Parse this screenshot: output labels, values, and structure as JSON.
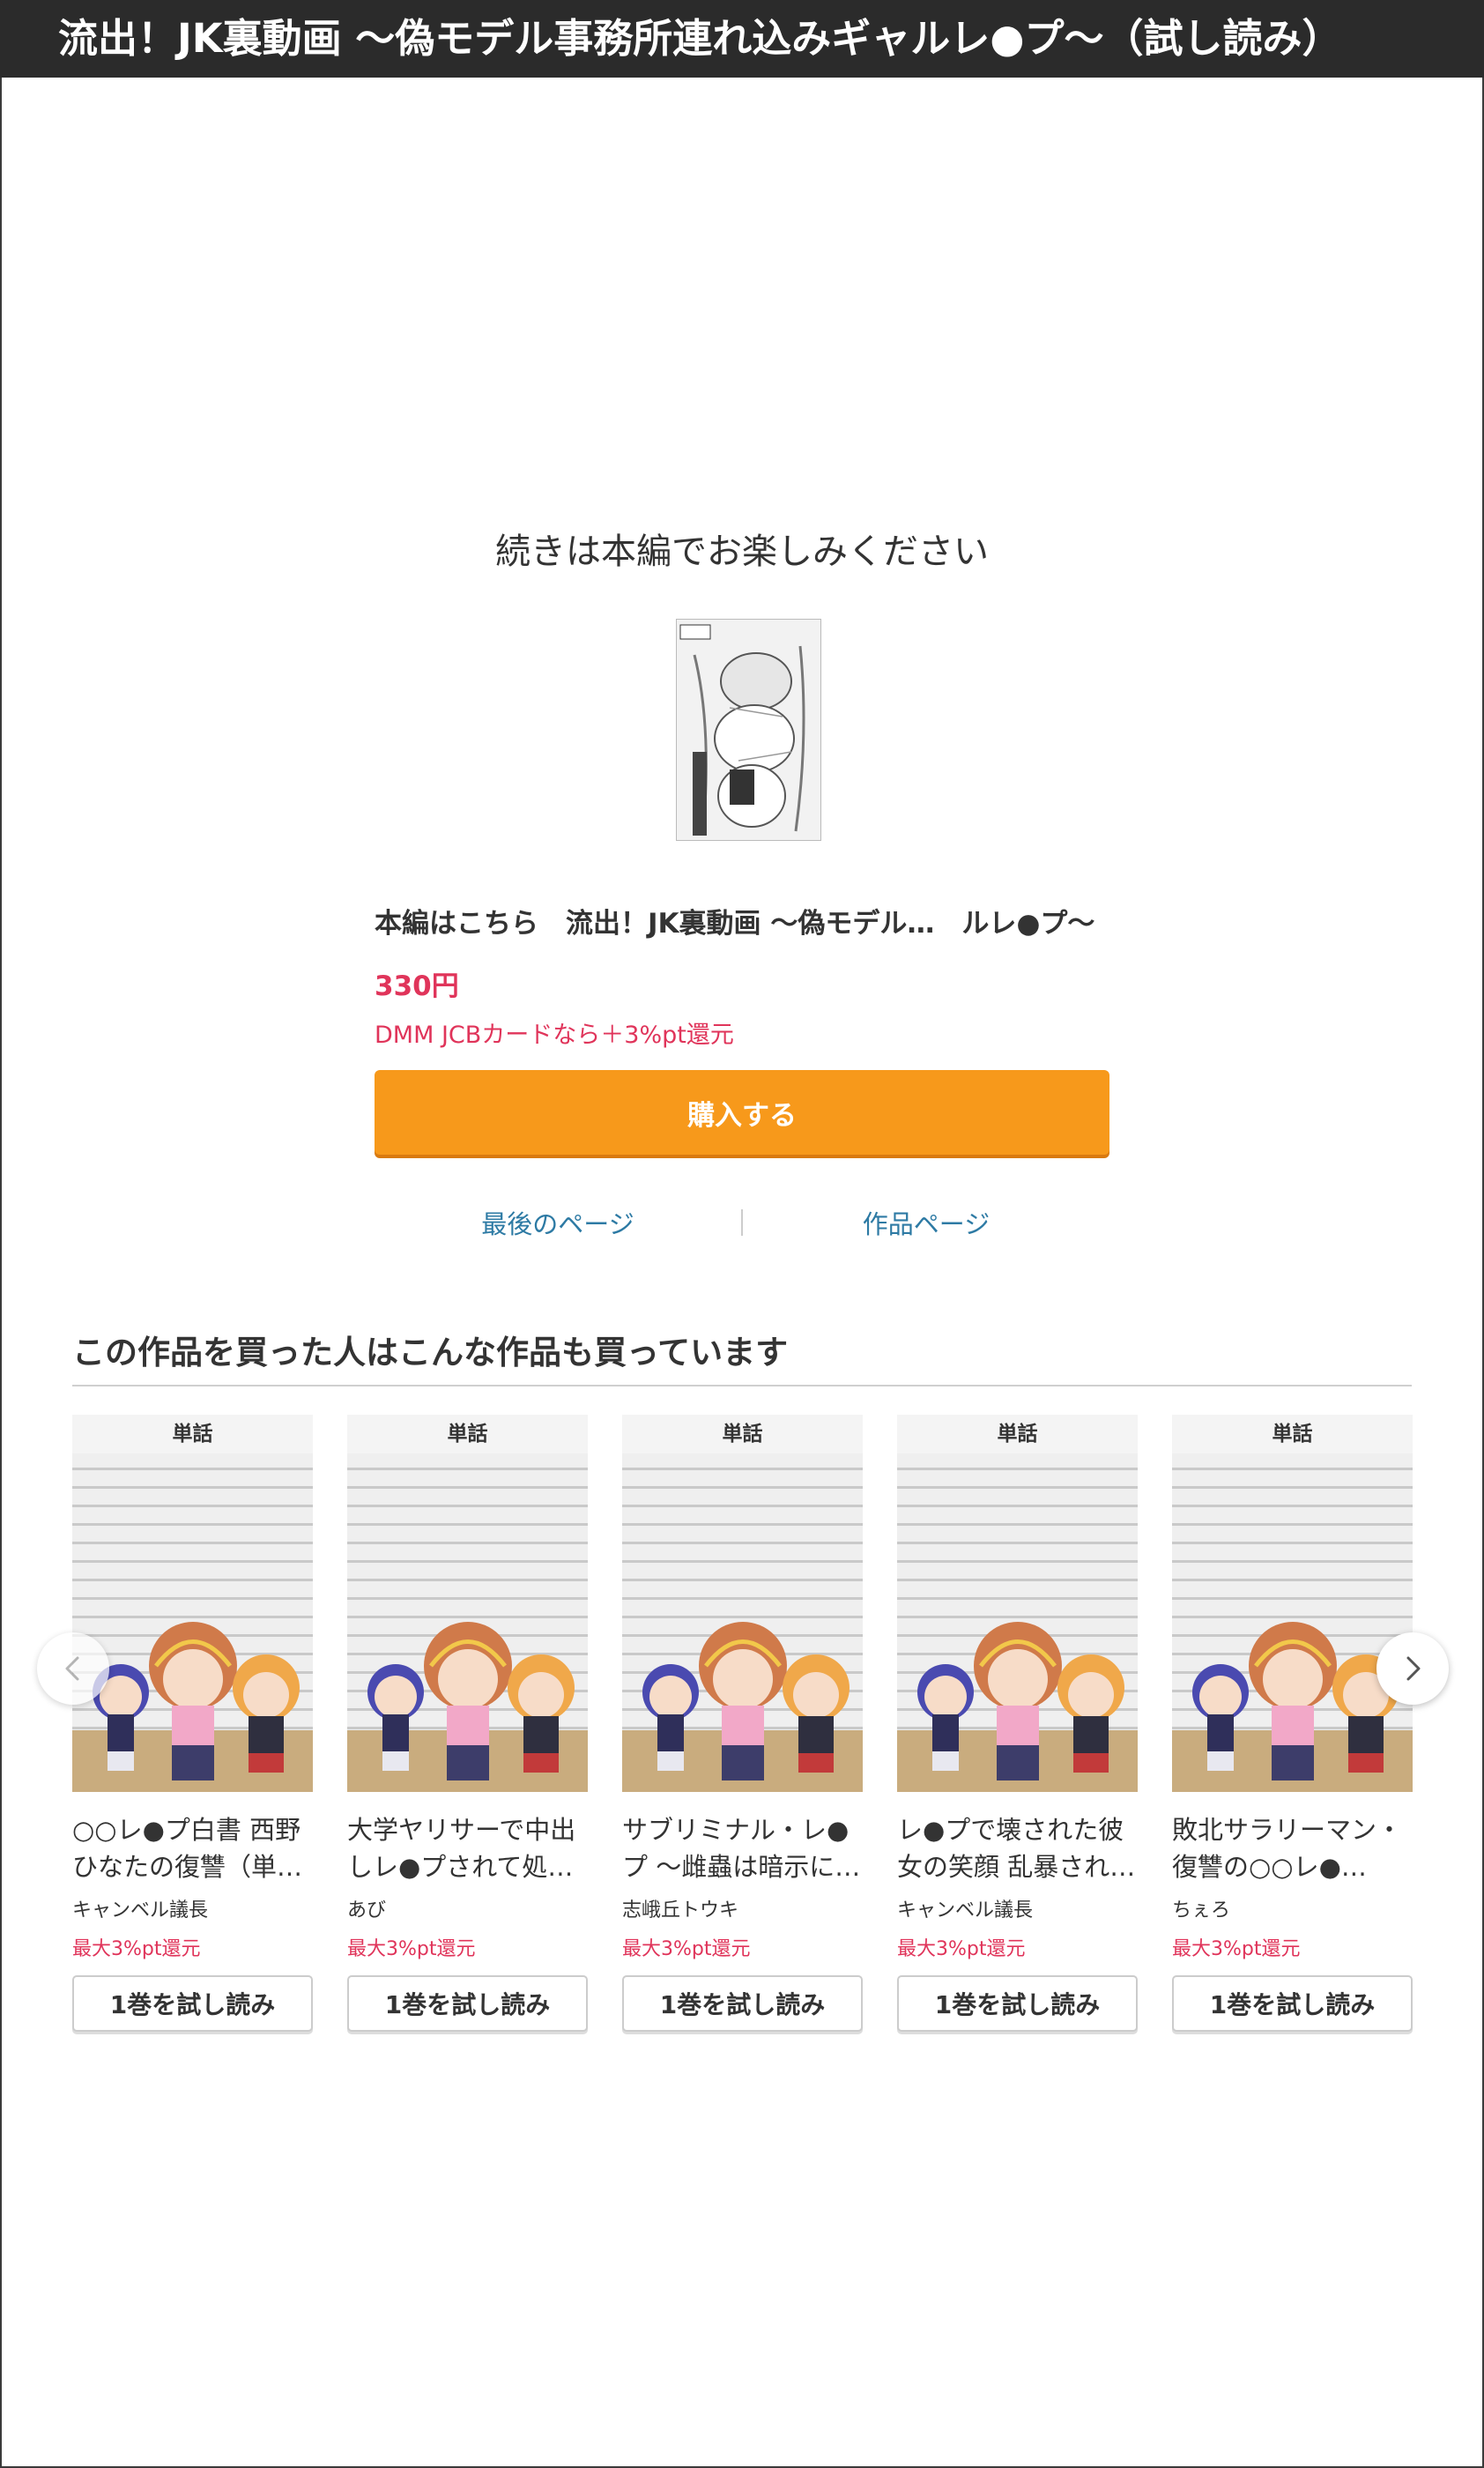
{
  "header": {
    "title": "流出！JK裏動画 〜偽モデル事務所連れ込みギャルレ●プ〜（試し読み）"
  },
  "main": {
    "continue_message": "続きは本編でお楽しみください",
    "product_title": "本編はこちら　流出！JK裏動画 〜偽モデル…　ルレ●プ〜",
    "price": "330円",
    "point_note": "DMM JCBカードなら＋3%pt還元",
    "buy_label": "購入する",
    "last_page_label": "最後のページ",
    "work_page_label": "作品ページ"
  },
  "recommendations": {
    "heading": "この作品を買った人はこんな作品も買っています",
    "items": [
      {
        "badge": "単話",
        "title": "○○レ●プ白書 西野ひなたの復讐（単…",
        "author": "キャンベル議長",
        "points": "最大3%pt還元",
        "button": "1巻を試し読み"
      },
      {
        "badge": "単話",
        "title": "大学ヤリサーで中出しレ●プされて処…",
        "author": "あび",
        "points": "最大3%pt還元",
        "button": "1巻を試し読み"
      },
      {
        "badge": "単話",
        "title": "サブリミナル・レ●プ 〜雌蟲は暗示に…",
        "author": "志峨丘トウキ",
        "points": "最大3%pt還元",
        "button": "1巻を試し読み"
      },
      {
        "badge": "単話",
        "title": "レ●プで壊された彼女の笑顔 乱暴され…",
        "author": "キャンベル議長",
        "points": "最大3%pt還元",
        "button": "1巻を試し読み"
      },
      {
        "badge": "単話",
        "title": "敗北サラリーマン・復讐の○○レ●…",
        "author": "ちぇろ",
        "points": "最大3%pt還元",
        "button": "1巻を試し読み"
      }
    ]
  },
  "colors": {
    "accent_price": "#e0345a",
    "buy_button": "#f7991b",
    "link": "#2d7aa4",
    "title_bar": "#2b2b2b"
  },
  "icons": {
    "prev": "chevron-left-icon",
    "next": "chevron-right-icon"
  }
}
